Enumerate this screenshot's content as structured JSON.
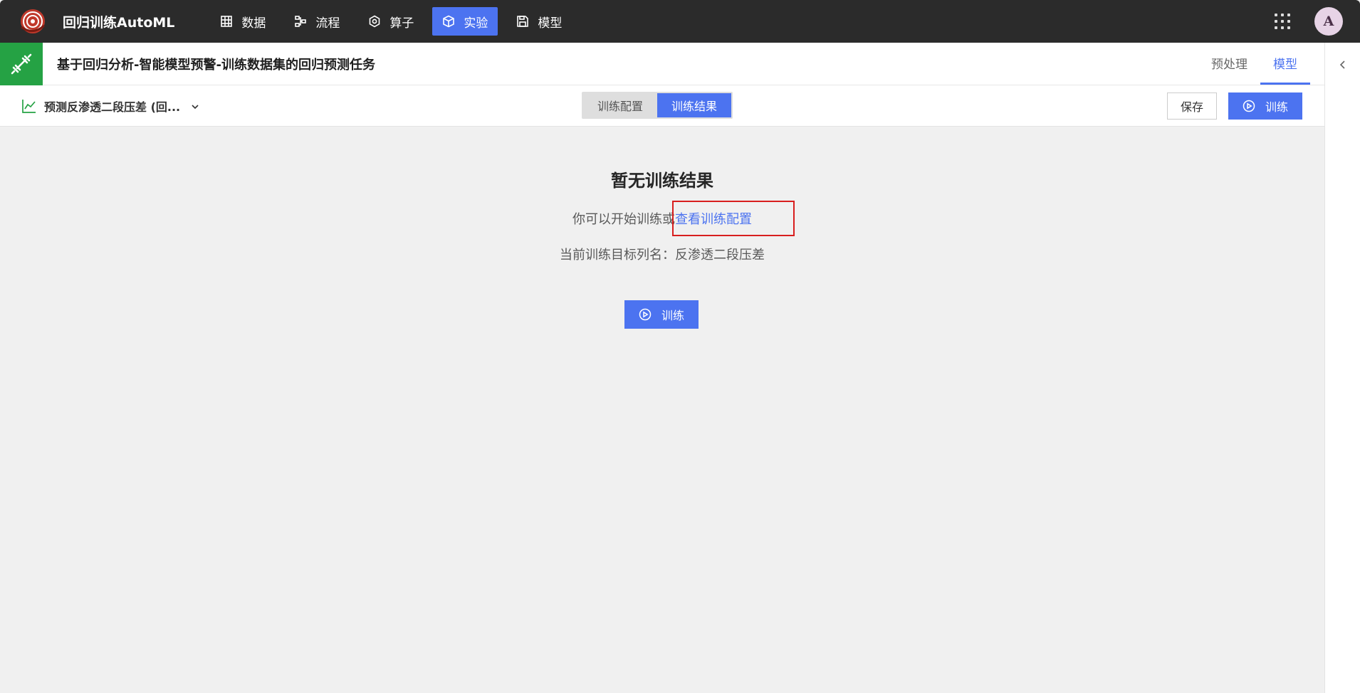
{
  "app": {
    "title": "回归训练AutoML",
    "user_initial": "A"
  },
  "nav": [
    {
      "label": "数据",
      "icon": "table-icon",
      "active": false
    },
    {
      "label": "流程",
      "icon": "flow-icon",
      "active": false
    },
    {
      "label": "算子",
      "icon": "hexagon-gear-icon",
      "active": false
    },
    {
      "label": "实验",
      "icon": "cube-icon",
      "active": true
    },
    {
      "label": "模型",
      "icon": "save-disk-icon",
      "active": false
    }
  ],
  "task": {
    "title": "基于回归分析-智能模型预警-训练数据集的回归预测任务",
    "tabs": [
      {
        "label": "预处理",
        "active": false
      },
      {
        "label": "模型",
        "active": true
      }
    ]
  },
  "toolbar": {
    "target_label": "预测反渗透二段压差 (回...",
    "segments": [
      {
        "label": "训练配置",
        "active": false
      },
      {
        "label": "训练结果",
        "active": true
      }
    ],
    "save_label": "保存",
    "train_label": "训练"
  },
  "empty_state": {
    "title": "暂无训练结果",
    "hint_prefix": "你可以开始训练或",
    "hint_link": "查看训练配置",
    "target_prefix": "当前训练目标列名：",
    "target_value": "反渗透二段压差",
    "train_label": "训练"
  },
  "colors": {
    "accent": "#4c73f0",
    "topbar": "#2b2b2b",
    "task_badge": "#25a244",
    "highlight": "#d81e1e"
  }
}
